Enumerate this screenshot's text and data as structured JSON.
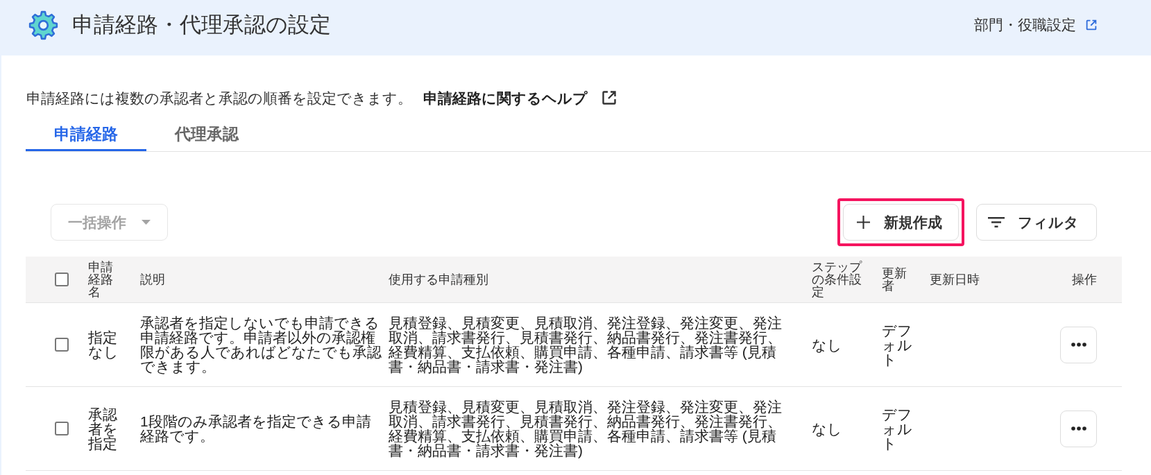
{
  "header": {
    "title": "申請経路・代理承認の設定",
    "link": "部門・役職設定"
  },
  "intro": {
    "text": "申請経路には複数の承認者と承認の順番を設定できます。",
    "help_link": "申請経路に関するヘルプ"
  },
  "tabs": [
    {
      "label": "申請経路",
      "selected": true
    },
    {
      "label": "代理承認",
      "selected": false
    }
  ],
  "toolbar": {
    "bulk_action": {
      "label": "一括操作",
      "disabled": true
    },
    "buttons": [
      {
        "kind": "create",
        "label": "新規作成",
        "highlighted": true
      },
      {
        "kind": "filter",
        "label": "フィルタ",
        "highlighted": false
      }
    ]
  },
  "table": {
    "select_all_checked": false,
    "columns": [
      "申請経路名",
      "説明",
      "使用する申請種別",
      "ステップの条件設定",
      "更新者",
      "更新日時",
      "操作"
    ],
    "rows": [
      {
        "checked": false,
        "name": "指定なし",
        "description": "承認者を指定しないでも申請できる申請経路です。申請者以外の承認権限がある人であればどなたでも承認できます。",
        "request_types": "見積登録、見積変更、見積取消、発注登録、発注変更、発注取消、請求書発行、見積書発行、納品書発行、発注書発行、経費精算、支払依頼、購買申請、各種申請、請求書等 (見積書・納品書・請求書・発注書)",
        "step_condition": "なし",
        "updated_by": "デフォルト"
      },
      {
        "checked": false,
        "name": "承認者を指定",
        "description": "1段階のみ承認者を指定できる申請経路です。",
        "request_types": "見積登録、見積変更、見積取消、発注登録、発注変更、発注取消、請求書発行、見積書発行、納品書発行、発注書発行、経費精算、支払依頼、購買申請、各種申請、請求書等 (見積書・納品書・請求書・発注書)",
        "step_condition": "なし",
        "updated_by": "デフォルト"
      }
    ]
  }
}
